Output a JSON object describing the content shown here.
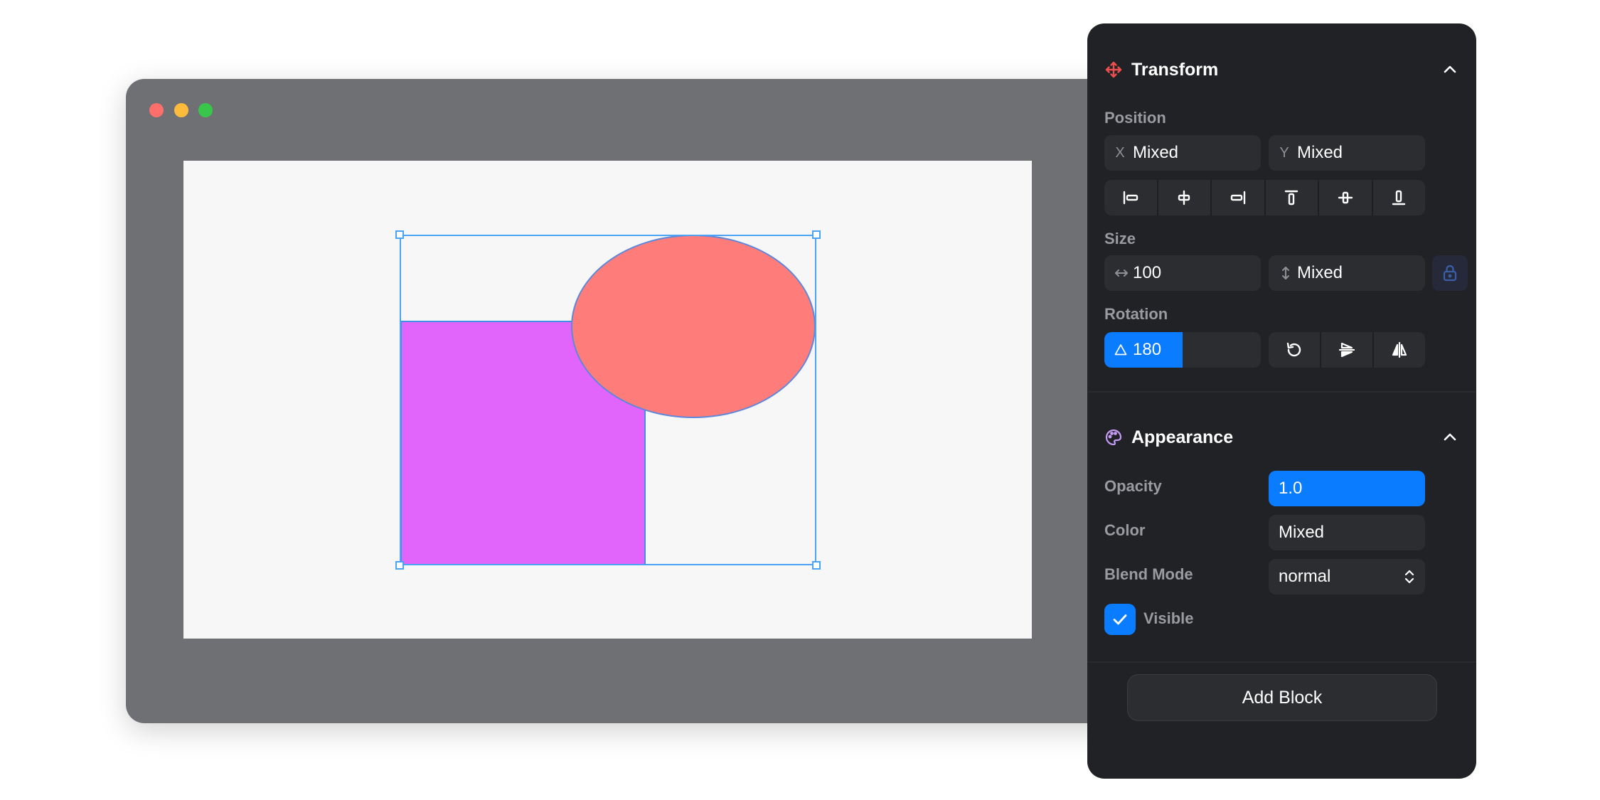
{
  "window": {
    "controls": [
      "close",
      "minimize",
      "maximize"
    ]
  },
  "transform": {
    "title": "Transform",
    "icon": "move-icon",
    "position_label": "Position",
    "x_prefix": "X",
    "x_value": "Mixed",
    "y_prefix": "Y",
    "y_value": "Mixed",
    "align_buttons": [
      "align-left-icon",
      "align-center-horizontal-icon",
      "align-right-icon",
      "align-top-icon",
      "align-center-vertical-icon",
      "align-bottom-icon"
    ],
    "size_label": "Size",
    "width_value": "100",
    "height_value": "Mixed",
    "rotation_label": "Rotation",
    "rotation_value": "180",
    "rotation_buttons": [
      "rotate-icon",
      "flip-vertical-icon",
      "flip-horizontal-icon"
    ]
  },
  "appearance": {
    "title": "Appearance",
    "icon": "palette-icon",
    "opacity_label": "Opacity",
    "opacity_value": "1.0",
    "color_label": "Color",
    "color_value": "Mixed",
    "blend_label": "Blend Mode",
    "blend_value": "normal",
    "visible_label": "Visible",
    "visible_checked": true
  },
  "add_block_label": "Add Block",
  "colors": {
    "accent": "#0a7cff",
    "rect_fill": "#e164fb",
    "ellipse_fill": "#fe7c7a",
    "selection": "#4aa3f5",
    "panel_bg": "#212225"
  }
}
